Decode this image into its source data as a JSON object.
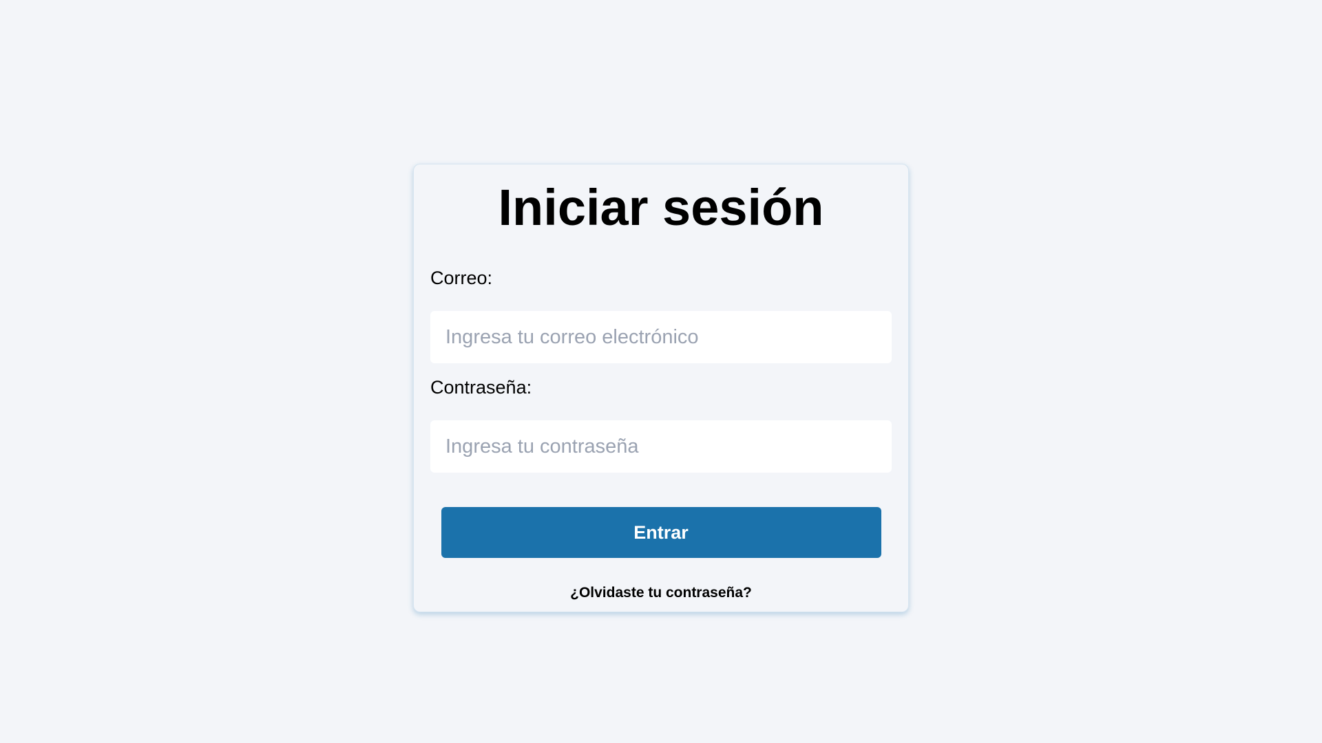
{
  "login": {
    "title": "Iniciar sesión",
    "email_label": "Correo:",
    "email_placeholder": "Ingresa tu correo electrónico",
    "password_label": "Contraseña:",
    "password_placeholder": "Ingresa tu contraseña",
    "submit_label": "Entrar",
    "forgot_link": "¿Olvidaste tu contraseña?"
  },
  "colors": {
    "background": "#f3f5f9",
    "button": "#1b72ab",
    "input_background": "#ffffff",
    "placeholder": "#9aa2b1"
  }
}
